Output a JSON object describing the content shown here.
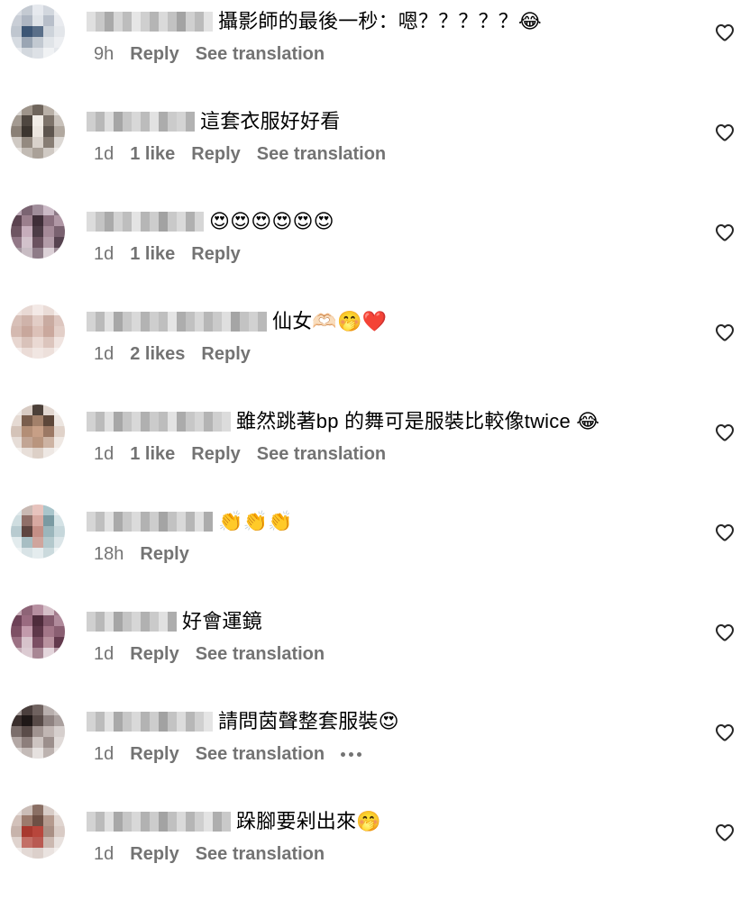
{
  "colors": {
    "text_primary": "#000000",
    "text_secondary": "#737373",
    "background": "#ffffff"
  },
  "icons": {
    "like": "heart-outline-icon",
    "more": "more-options-icon"
  },
  "labels": {
    "reply": "Reply",
    "see_translation": "See translation"
  },
  "comments": [
    {
      "text": "攝影師的最後一秒：嗯？？？？？😂",
      "time": "9h",
      "likes": "",
      "show_translation": true,
      "show_more": false,
      "avatar_palette": [
        "#d9dde3",
        "#c4cad2",
        "#e6e9ee",
        "#d2d7de",
        "#eef0f3",
        "#c9ced6",
        "#aeb6c2",
        "#dfe3e8",
        "#b8bfca",
        "#e9ebef",
        "#bfc6cf",
        "#3d5675",
        "#5a6f89",
        "#cdd3da",
        "#e3e6ea",
        "#d6dbe1",
        "#9aa5b3",
        "#c2c9d1",
        "#e0e4e8",
        "#eceef1",
        "#e8eaee",
        "#d3d8de",
        "#dde1e6",
        "#f0f2f4",
        "#e4e7eb"
      ],
      "username_palette": [
        "#e0e0e0",
        "#c8c8c8",
        "#a9a9a9",
        "#d6d6d6",
        "#bdbdbd",
        "#e6e6e6",
        "#cfcfcf",
        "#b5b5b5",
        "#dadada",
        "#c2c2c2",
        "#a3a3a3",
        "#d0d0d0",
        "#bbbbbb",
        "#e3e3e3"
      ]
    },
    {
      "text": "這套衣服好好看",
      "time": "1d",
      "likes": "1 like",
      "show_translation": true,
      "show_more": false,
      "avatar_palette": [
        "#d7d3cf",
        "#9e948a",
        "#6f655c",
        "#b9b0a7",
        "#e1ddd9",
        "#a39a91",
        "#4f4740",
        "#f1ece6",
        "#7d736a",
        "#c8c1ba",
        "#8a8076",
        "#3c352f",
        "#ebe5de",
        "#5d554e",
        "#b1a89f",
        "#cfc9c3",
        "#948a80",
        "#d9d2cb",
        "#877d74",
        "#dcd8d4",
        "#e6e2de",
        "#c2bbb4",
        "#aaa198",
        "#d0cac4",
        "#ecE9e6"
      ],
      "username_palette": [
        "#cfcfcf",
        "#b8b8b8",
        "#dedede",
        "#a6a6a6",
        "#c6c6c6",
        "#d8d8d8",
        "#bcbcbc",
        "#e2e2e2",
        "#acacac",
        "#cbcbcb",
        "#d4d4d4",
        "#b2b2b2"
      ]
    },
    {
      "text": "😍😍😍😍😍😍",
      "time": "1d",
      "likes": "1 like",
      "show_translation": false,
      "show_more": false,
      "avatar_palette": [
        "#b9a6b3",
        "#7b6472",
        "#a08d9a",
        "#cbbac6",
        "#8d7a87",
        "#5b4350",
        "#9b7f8d",
        "#3f2e38",
        "#8a6f7e",
        "#b097a5",
        "#6e5562",
        "#c6adbb",
        "#4d3c46",
        "#a58a98",
        "#7a6270",
        "#927887",
        "#d2c2cb",
        "#6b525f",
        "#b39ca8",
        "#574350",
        "#a89aa3",
        "#c8bcc3",
        "#8f7c88",
        "#dcd1d7",
        "#9d8b96"
      ],
      "username_palette": [
        "#dcdcdc",
        "#c4c4c4",
        "#aaaaaa",
        "#d2d2d2",
        "#bebebe",
        "#e4e4e4",
        "#b6b6b6",
        "#cdcdcd",
        "#a2a2a2",
        "#c9c9c9",
        "#dadada",
        "#b0b0b0",
        "#d6d6d6"
      ]
    },
    {
      "text": "仙女🫶🏻🤭❤️",
      "time": "1d",
      "likes": "2 likes",
      "show_translation": false,
      "show_more": false,
      "avatar_palette": [
        "#efe3df",
        "#e8d9d4",
        "#f3e9e6",
        "#eadcd7",
        "#f6efed",
        "#d8c0b8",
        "#cfb3aa",
        "#e2cdc6",
        "#c9aba1",
        "#ddc6bf",
        "#d4b9b0",
        "#c8a79c",
        "#dcc1b8",
        "#caa89d",
        "#e3cfc8",
        "#e7d6d0",
        "#d9c2ba",
        "#ead9d3",
        "#dcc5bd",
        "#f0e4e0",
        "#f4ecea",
        "#ebdcd7",
        "#f1e6e2",
        "#ede0db",
        "#f7f1ef"
      ],
      "username_palette": [
        "#d4d4d4",
        "#bababa",
        "#e1e1e1",
        "#a8a8a8",
        "#c8c8c8",
        "#d9d9d9",
        "#b3b3b3",
        "#cecece",
        "#bfbfbf",
        "#e5e5e5",
        "#adadad",
        "#c1c1c1",
        "#d7d7d7",
        "#b7b7b7",
        "#cacaca",
        "#dfdfdf",
        "#a5a5a5",
        "#c3c3c3",
        "#d1d1d1",
        "#b9b9b9"
      ]
    },
    {
      "text": "雖然跳著bp 的舞可是服裝比較像twice 😂",
      "time": "1d",
      "likes": "1 like",
      "show_translation": true,
      "show_more": false,
      "avatar_palette": [
        "#f0ebe8",
        "#d8cbc3",
        "#4c4039",
        "#e2d7d0",
        "#f3efec",
        "#e5dad3",
        "#7a5e4d",
        "#a2806a",
        "#5d473a",
        "#ece5e0",
        "#d4c3b8",
        "#b38e76",
        "#c79f86",
        "#9b7864",
        "#e0d2c9",
        "#e6ddd7",
        "#c2a594",
        "#b9957e",
        "#cdb3a3",
        "#efe8e3",
        "#f4f0ed",
        "#e8dfd9",
        "#ddd0c7",
        "#eee8e4",
        "#f6f3f1"
      ],
      "username_palette": [
        "#d2d2d2",
        "#bbbbbb",
        "#e0e0e0",
        "#a7a7a7",
        "#c5c5c5",
        "#d8d8d8",
        "#b0b0b0",
        "#cbcbcb",
        "#bdbdbd",
        "#e3e3e3",
        "#ababab",
        "#c7c7c7",
        "#d5d5d5",
        "#b4b4b4",
        "#cfcfcf",
        "#dcdcdc"
      ]
    },
    {
      "text": "👏👏👏",
      "time": "18h",
      "likes": "",
      "show_translation": false,
      "show_more": false,
      "avatar_palette": [
        "#dfe8ea",
        "#c9b9b3",
        "#e7c3bd",
        "#a9c5cb",
        "#e9eef0",
        "#cfdde0",
        "#8f6f68",
        "#d7a9a1",
        "#7a9aa2",
        "#d4e2e5",
        "#b8cbd0",
        "#5e4540",
        "#c48f86",
        "#9bb6bc",
        "#c6d7db",
        "#e2ebed",
        "#a7bec3",
        "#cfa59d",
        "#b3c8cc",
        "#dbe5e8",
        "#eef3f4",
        "#d8e3e6",
        "#e4ecee",
        "#cbdadd",
        "#f1f5f6"
      ],
      "username_palette": [
        "#d6d6d6",
        "#bfbfbf",
        "#e2e2e2",
        "#aaaaaa",
        "#c8c8c8",
        "#dbdbdb",
        "#b2b2b2",
        "#cdcdcd",
        "#a4a4a4",
        "#c2c2c2",
        "#d9d9d9",
        "#b6b6b6",
        "#e0e0e0",
        "#acacac"
      ]
    },
    {
      "text": "好會運鏡",
      "time": "1d",
      "likes": "",
      "show_translation": true,
      "show_more": false,
      "avatar_palette": [
        "#c4a9b4",
        "#8e6477",
        "#b68fa0",
        "#d5bfc8",
        "#a37c8d",
        "#6d4257",
        "#9a6b80",
        "#4f2c3c",
        "#845a6d",
        "#b08a9b",
        "#7d5064",
        "#c29aab",
        "#5e3749",
        "#a37688",
        "#8a5f72",
        "#9c7284",
        "#d7c3cb",
        "#7b4f63",
        "#b9929f",
        "#633a4d",
        "#c9b1bb",
        "#dccbd2",
        "#a88794",
        "#e4d6dc",
        "#b79aa6"
      ],
      "username_palette": [
        "#d0d0d0",
        "#b9b9b9",
        "#dedede",
        "#a6a6a6",
        "#c4c4c4",
        "#d6d6d6",
        "#b1b1b1",
        "#cacaca",
        "#e1e1e1",
        "#adadad"
      ]
    },
    {
      "text": "請問茵聲整套服裝😍",
      "time": "1d",
      "likes": "",
      "show_translation": true,
      "show_more": true,
      "avatar_palette": [
        "#9e9593",
        "#4b3f3d",
        "#6f625f",
        "#b8afad",
        "#c9c2c0",
        "#3a2f2d",
        "#1f1817",
        "#574a47",
        "#8e8280",
        "#aaa09e",
        "#7b6e6b",
        "#5a4c49",
        "#a09390",
        "#c1b6b3",
        "#d6cfcd",
        "#b3a8a5",
        "#8d7f7c",
        "#cdc4c1",
        "#9c8f8c",
        "#e0dad8",
        "#d9d3d1",
        "#c4bbb8",
        "#e6e1df",
        "#bdb3b0",
        "#eae6e4"
      ],
      "username_palette": [
        "#d4d4d4",
        "#bcbcbc",
        "#e2e2e2",
        "#a9a9a9",
        "#c7c7c7",
        "#d9d9d9",
        "#b3b3b3",
        "#cdcdcd",
        "#a2a2a2",
        "#c3c3c3",
        "#dcdcdc",
        "#b7b7b7",
        "#d0d0d0",
        "#e5e5e5"
      ]
    },
    {
      "text": "跺腳要剁出來🤭",
      "time": "1d",
      "likes": "",
      "show_translation": true,
      "show_more": false,
      "avatar_palette": [
        "#e6dedb",
        "#cbbdb7",
        "#8a6f64",
        "#d8ccc7",
        "#eee8e5",
        "#d2c1ba",
        "#9c7b6d",
        "#6e5045",
        "#b59a8e",
        "#e0d5d0",
        "#c7b3ab",
        "#a8392f",
        "#b8463c",
        "#a98f84",
        "#d9cbc5",
        "#dfd3ce",
        "#c36f66",
        "#b95a52",
        "#cbb8b0",
        "#e8e1de",
        "#f0ebe9",
        "#e3d9d5",
        "#dcd0cb",
        "#eae3e0",
        "#f3efed"
      ],
      "username_palette": [
        "#d3d3d3",
        "#bbbbbb",
        "#e0e0e0",
        "#a8a8a8",
        "#c6c6c6",
        "#d8d8d8",
        "#b2b2b2",
        "#cccccc",
        "#a3a3a3",
        "#c0c0c0",
        "#dadada",
        "#b5b5b5",
        "#cfcfcf",
        "#e3e3e3",
        "#aeaeae",
        "#c9c9c9"
      ]
    }
  ]
}
